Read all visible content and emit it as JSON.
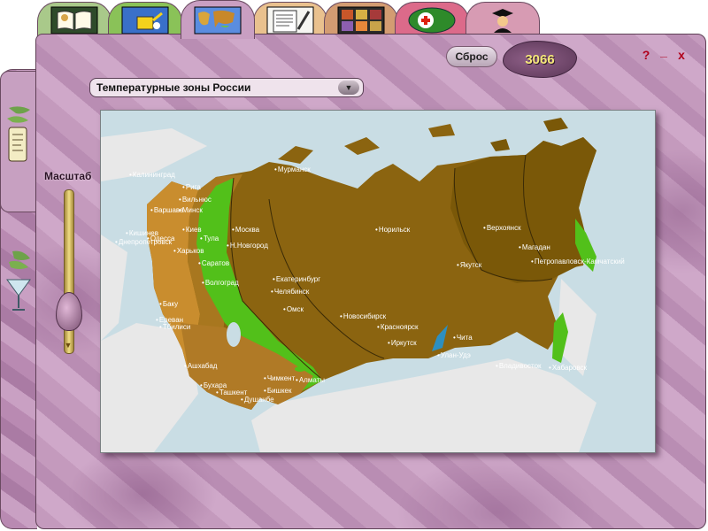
{
  "tabs": [
    {
      "name": "book-tab",
      "icon": "open-book-icon"
    },
    {
      "name": "watering-tab",
      "icon": "watering-can-icon"
    },
    {
      "name": "map-tab",
      "icon": "world-map-icon",
      "active": true
    },
    {
      "name": "notes-tab",
      "icon": "notepad-icon"
    },
    {
      "name": "catalog-tab",
      "icon": "photo-grid-icon"
    },
    {
      "name": "health-tab",
      "icon": "medical-cross-icon"
    },
    {
      "name": "scholar-tab",
      "icon": "graduate-icon"
    }
  ],
  "toolbar": {
    "reset_label": "Сброс",
    "counter_value": "3066",
    "help": "?",
    "minimize": "_",
    "close": "x"
  },
  "dropdown": {
    "selected": "Температурные зоны России"
  },
  "scale": {
    "label": "Масштаб",
    "level": 0.72
  },
  "colors": {
    "window": "#c49abd",
    "zone_dark": "#7a5808",
    "zone_mid": "#8b6410",
    "zone_light": "#b07a26",
    "zone_green": "#52c01a",
    "water": "#c9dde4",
    "land_grey": "#e6e6e6"
  },
  "map": {
    "cities": [
      {
        "name": "Калининград"
      },
      {
        "name": "Рига"
      },
      {
        "name": "Вильнюс"
      },
      {
        "name": "Минск"
      },
      {
        "name": "Варшава"
      },
      {
        "name": "Москва"
      },
      {
        "name": "Тула"
      },
      {
        "name": "Н.Новгород"
      },
      {
        "name": "Киев"
      },
      {
        "name": "Одесса"
      },
      {
        "name": "Кишинев"
      },
      {
        "name": "Харьков"
      },
      {
        "name": "Саратов"
      },
      {
        "name": "Волгоград"
      },
      {
        "name": "Мурманск"
      },
      {
        "name": "Екатеринбург"
      },
      {
        "name": "Челябинск"
      },
      {
        "name": "Омск"
      },
      {
        "name": "Новосибирск"
      },
      {
        "name": "Норильск"
      },
      {
        "name": "Красноярск"
      },
      {
        "name": "Иркутск"
      },
      {
        "name": "Улан-Удэ"
      },
      {
        "name": "Чита"
      },
      {
        "name": "Якутск"
      },
      {
        "name": "Верхоянск"
      },
      {
        "name": "Магадан"
      },
      {
        "name": "Петропавловск-Камчатский"
      },
      {
        "name": "Владивосток"
      },
      {
        "name": "Хабаровск"
      },
      {
        "name": "Ашхабад"
      },
      {
        "name": "Бухара"
      },
      {
        "name": "Ташкент"
      },
      {
        "name": "Чимкент"
      },
      {
        "name": "Душанбе"
      },
      {
        "name": "Бишкек"
      },
      {
        "name": "Алматы"
      },
      {
        "name": "Тбилиси"
      },
      {
        "name": "Ереван"
      },
      {
        "name": "Баку"
      },
      {
        "name": "Днепропетровск"
      }
    ]
  }
}
